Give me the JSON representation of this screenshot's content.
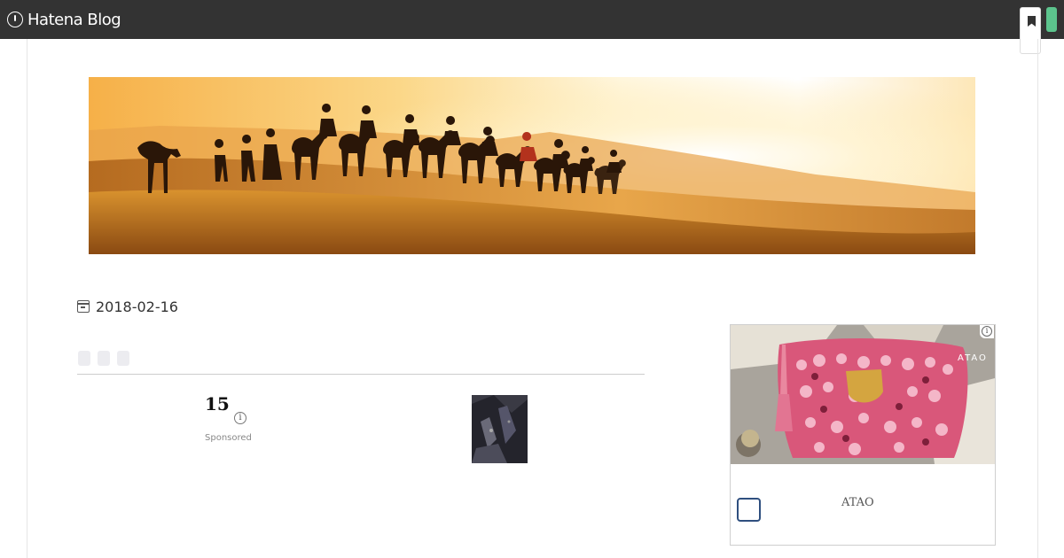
{
  "topbar": {
    "logo_text": "Hatena Blog",
    "logo_icon": "hatena-logo-icon",
    "bookmark_icon": "bookmark-icon",
    "colors": {
      "bar": "#333333",
      "accent": "#5cc48d"
    }
  },
  "header": {
    "banner_image": "desert-camel-caravan-sunset"
  },
  "entry": {
    "date": "2018-02-16",
    "date_icon": "calendar-icon"
  },
  "inline_ad": {
    "number": "15",
    "info_icon": "info-icon",
    "label": "Sponsored",
    "thumbnail": "dark-textured-image"
  },
  "side_ad": {
    "brand_on_image": "ATAO",
    "advertiser": "ATAO",
    "choices_icon": "ad-choices-icon",
    "image": "pink-mosaic-wallet"
  }
}
